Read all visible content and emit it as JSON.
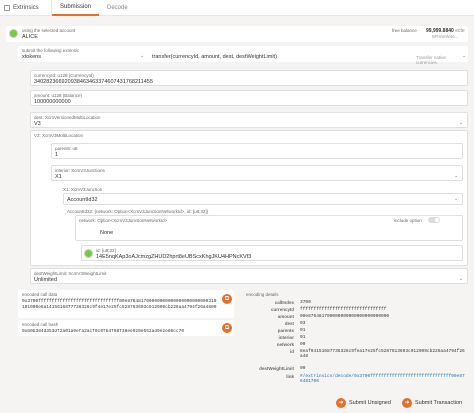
{
  "app": {
    "name": "Extrinsics"
  },
  "tabs": [
    {
      "label": "Submission"
    },
    {
      "label": "Decode"
    }
  ],
  "account": {
    "label": "using the selected account",
    "name": "ALICE",
    "balance_label": "free balance",
    "balance": "99,999.8840",
    "balance_unit": "ecte",
    "address": "5FHneW46..."
  },
  "extrinsic": {
    "label": "submit the following extrinsic",
    "module": "xtokens",
    "call": "transfer(currencyId, amount, dest, destWeightLimit)",
    "hint": "Transfer native currencies."
  },
  "currencyId": {
    "label": "currencyId: u128 (CurrencyId)",
    "value": "340282366920938463463374607431768211455"
  },
  "amount": {
    "label": "amount: u128 (Balance)",
    "value": "100000000000"
  },
  "dest": {
    "label": "dest: XcmVersionedMultiLocation",
    "value": "V3"
  },
  "v3": {
    "label": "V3: XcmV3MultiLocation"
  },
  "parents": {
    "label": "parents: u8",
    "value": "1"
  },
  "interior": {
    "label": "interior: XcmV3Junctions",
    "value": "X1"
  },
  "x1": {
    "label": "X1: XcmV3Junction",
    "value": "AccountId32"
  },
  "accountId32": {
    "label": "AccountId32: {network: Option<XcmV3JunctionNetworkId>, id: [u8;32]}"
  },
  "network": {
    "label": "network: Option<XcmV3JunctionNetworkId>",
    "include_label": "include option",
    "value": "None"
  },
  "id": {
    "label": "id: [u8;32]",
    "value": "14E5nqKAp3oAJcmzgZHUD2hprt8eUBScxKhgJKU4HPNcKVf3"
  },
  "destWeight": {
    "label": "destWeightLimit: XcmV3WeightLimit",
    "value": "Unlimited"
  },
  "encodedData": {
    "label": "encoded call data",
    "value": "0x3700ffffffffffffffffffffffffffffff00e876481700000000000000000000000310101000e6a1415616877736326c9f4e17e25fc528763693c912909cb226aa4794f26a4800"
  },
  "encodedHash": {
    "label": "encoded call hash",
    "value": "0xb0b384d353df2a01a9efa2acf0c0fb4f68f38ee920e552ad9e2e66cc70"
  },
  "details": {
    "label": "encoding details",
    "rows": [
      {
        "k": "callIndex",
        "v": "3700"
      },
      {
        "k": "currencyId",
        "v": "ffffffffffffffffffffffffffffffff"
      },
      {
        "k": "amount",
        "v": "00e876481700000000000000000000000"
      },
      {
        "k": "dest",
        "v": "03"
      },
      {
        "k": "parents",
        "v": "01"
      },
      {
        "k": "interior",
        "v": "01"
      },
      {
        "k": "network",
        "v": "00"
      },
      {
        "k": "id",
        "v": "8eaf04151687736326c9fea17e25fc5287613693c912909cb226aa4794f26a48"
      },
      {
        "k": "destWeightLimit",
        "v": "00"
      },
      {
        "k": "link",
        "v": "#/extrinsics/decode/0x3700ffffffffffffffffffffffffffffff00e876481700"
      }
    ]
  },
  "actions": {
    "unsigned": "Submit Unsigned",
    "transaction": "Submit Transaction"
  },
  "colors": {
    "accent": "#e4702b",
    "avatar": "#7ac943"
  }
}
